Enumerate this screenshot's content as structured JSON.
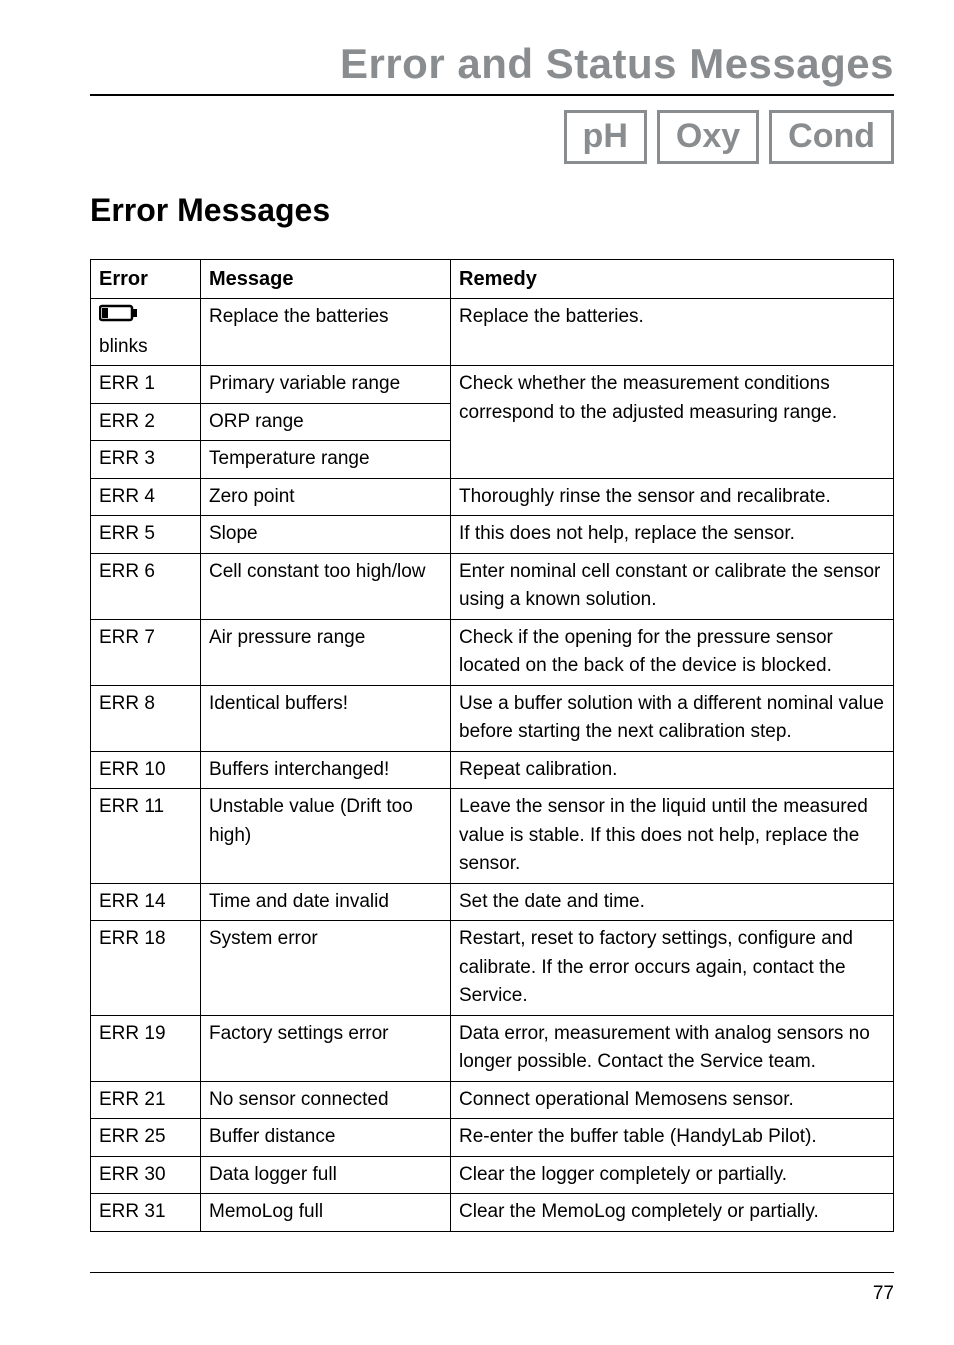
{
  "page": {
    "title": "Error and Status Messages",
    "subtitle": "Error Messages",
    "tags": [
      "pH",
      "Oxy",
      "Cond"
    ],
    "number": "77"
  },
  "table": {
    "headers": {
      "error": "Error",
      "message": "Message",
      "remedy": "Remedy"
    },
    "battery_blinks_label": "blinks",
    "battery_msg": "Replace the batteries",
    "battery_remedy": "Replace the batteries.",
    "err1": {
      "code": "ERR 1",
      "msg": "Primary variable range"
    },
    "err2": {
      "code": "ERR 2",
      "msg": "ORP range"
    },
    "err3": {
      "code": "ERR 3",
      "msg": "Temperature range"
    },
    "err1_3_remedy": "Check whether the measurement conditions correspond to the adjusted measuring range.",
    "err4": {
      "code": "ERR 4",
      "msg": "Zero point",
      "remedy": "Thoroughly rinse the sensor and recalibrate."
    },
    "err5": {
      "code": "ERR 5",
      "msg": "Slope",
      "remedy": "If this does not help, replace the sensor."
    },
    "err6": {
      "code": "ERR 6",
      "msg": "Cell constant too high/low",
      "remedy": "Enter nominal cell constant or calibrate the sensor using a known solution."
    },
    "err7": {
      "code": "ERR 7",
      "msg": "Air pressure range",
      "remedy": "Check if the opening for the pressure sensor located on the back of the device is blocked."
    },
    "err8": {
      "code": "ERR 8",
      "msg": "Identical buffers!",
      "remedy": "Use a buffer solution with a different nominal value before starting the next calibration step."
    },
    "err10": {
      "code": "ERR 10",
      "msg": "Buffers interchanged!",
      "remedy": "Repeat calibration."
    },
    "err11": {
      "code": "ERR 11",
      "msg": "Unstable value (Drift too high)",
      "remedy": "Leave the sensor in the liquid until the measured value is stable. If this does not help, replace the sensor."
    },
    "err14": {
      "code": "ERR 14",
      "msg": "Time and date invalid",
      "remedy": "Set the date and time."
    },
    "err18": {
      "code": "ERR 18",
      "msg": "System error",
      "remedy": "Restart, reset to factory settings, configure and calibrate. If the error occurs again, contact the Service."
    },
    "err19": {
      "code": "ERR 19",
      "msg": "Factory settings error",
      "remedy": "Data error, measurement with analog sensors no longer possible. Contact the Service team."
    },
    "err21": {
      "code": "ERR 21",
      "msg": "No sensor connected",
      "remedy": "Connect operational Memosens sensor."
    },
    "err25": {
      "code": "ERR 25",
      "msg": "Buffer distance",
      "remedy": "Re-enter the buffer table (HandyLab Pilot)."
    },
    "err30": {
      "code": "ERR 30",
      "msg": "Data logger full",
      "remedy": "Clear the logger completely or partially."
    },
    "err31": {
      "code": "ERR 31",
      "msg": "MemoLog full",
      "remedy": "Clear the MemoLog completely or partially."
    }
  }
}
